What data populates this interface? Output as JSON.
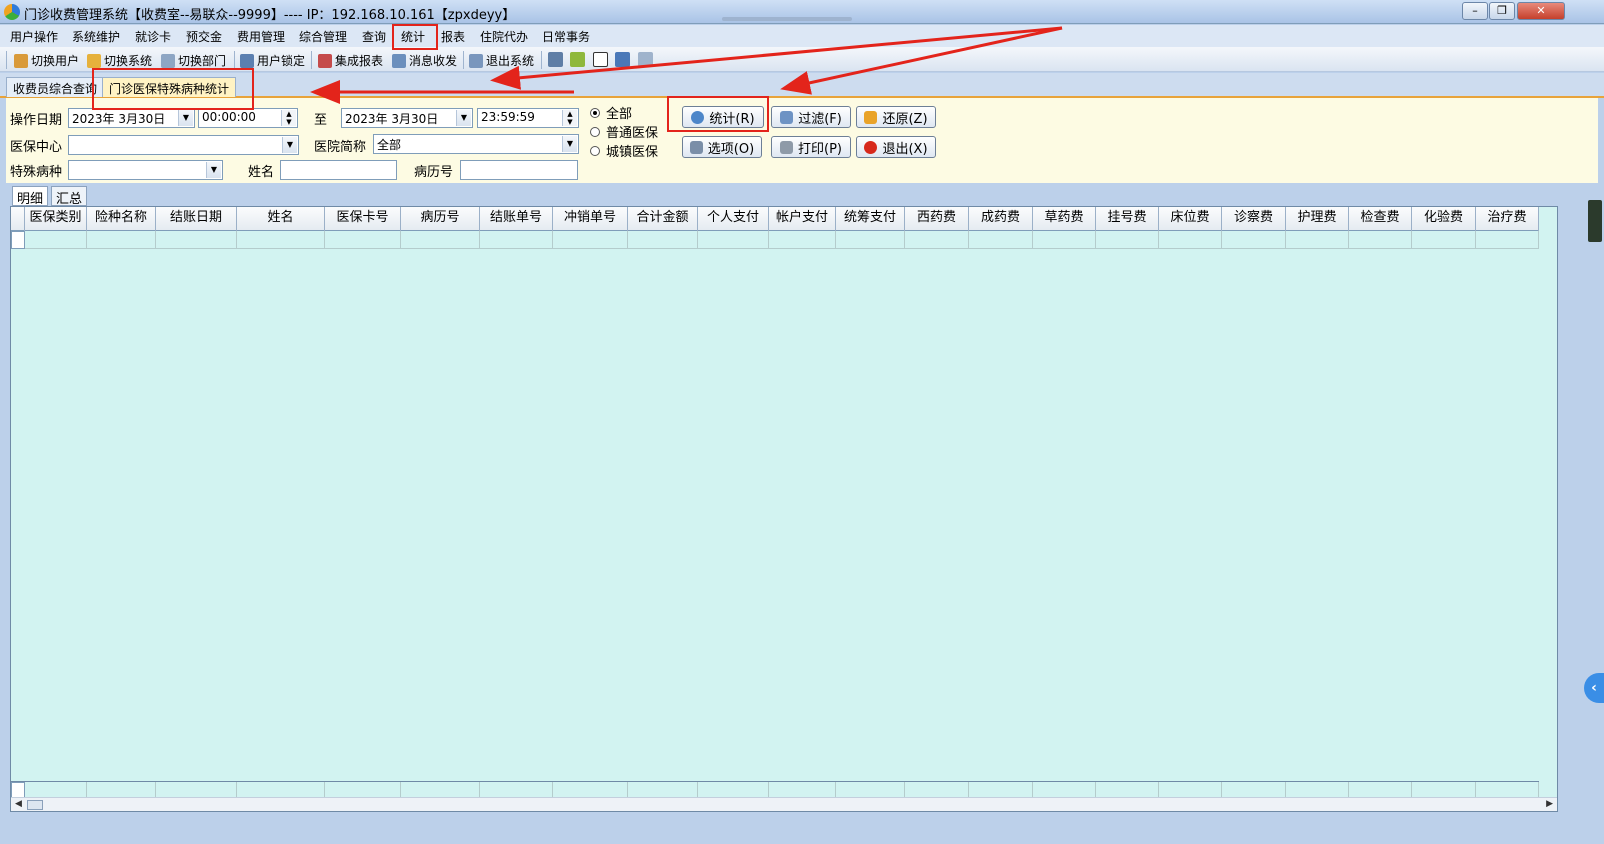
{
  "window": {
    "title": "门诊收费管理系统【收费室--易联众--9999】---- IP：192.168.10.161【zpxdeyy】",
    "minimize": "–",
    "restore": "❐",
    "close": "✕"
  },
  "menu": [
    "用户操作",
    "系统维护",
    "就诊卡",
    "预交金",
    "费用管理",
    "综合管理",
    "查询",
    "统计",
    "报表",
    "住院代办",
    "日常事务"
  ],
  "toolbar": {
    "items": [
      "切换用户",
      "切换系统",
      "切换部门",
      "用户锁定",
      "集成报表",
      "消息收发",
      "退出系统"
    ],
    "icons": [
      "switch-user-icon",
      "switch-system-icon",
      "switch-department-icon",
      "lock-user-icon",
      "report-icon",
      "message-icon",
      "exit-system-icon",
      "edit-icon",
      "currency-icon",
      "checkbox-icon",
      "window-split-icon",
      "calendar-icon"
    ]
  },
  "doc_tabs": [
    "收费员综合查询",
    "门诊医保特殊病种统计"
  ],
  "form": {
    "op_date_label": "操作日期",
    "start_date": "2023年 3月30日",
    "start_time": "00:00:00",
    "to_label": "至",
    "end_date": "2023年 3月30日",
    "end_time": "23:59:59",
    "center_label": "医保中心",
    "center_value": "",
    "hospital_label": "医院简称",
    "hospital_value": "全部",
    "disease_label": "特殊病种",
    "disease_value": "",
    "name_label": "姓名",
    "name_value": "",
    "record_label": "病历号",
    "record_value": "",
    "radios": [
      "全部",
      "普通医保",
      "城镇医保"
    ],
    "radio_selected": 0,
    "buttons": {
      "stat": "统计(R)",
      "filter": "过滤(F)",
      "restore": "还原(Z)",
      "options": "选项(O)",
      "print": "打印(P)",
      "exit": "退出(X)"
    }
  },
  "sub_tabs": [
    "明细",
    "汇总"
  ],
  "grid": {
    "columns": [
      "医保类别",
      "险种名称",
      "结账日期",
      "姓名",
      "医保卡号",
      "病历号",
      "结账单号",
      "冲销单号",
      "合计金额",
      "个人支付",
      "帐户支付",
      "统筹支付",
      "西药费",
      "成药费",
      "草药费",
      "挂号费",
      "床位费",
      "诊察费",
      "护理费",
      "检查费",
      "化验费",
      "治疗费"
    ],
    "rows": []
  },
  "colors": {
    "highlight": "#e3241b",
    "grid_bg": "#d2f3f1",
    "form_bg": "#fdfbe3",
    "active_tab": "#fff3c4"
  }
}
